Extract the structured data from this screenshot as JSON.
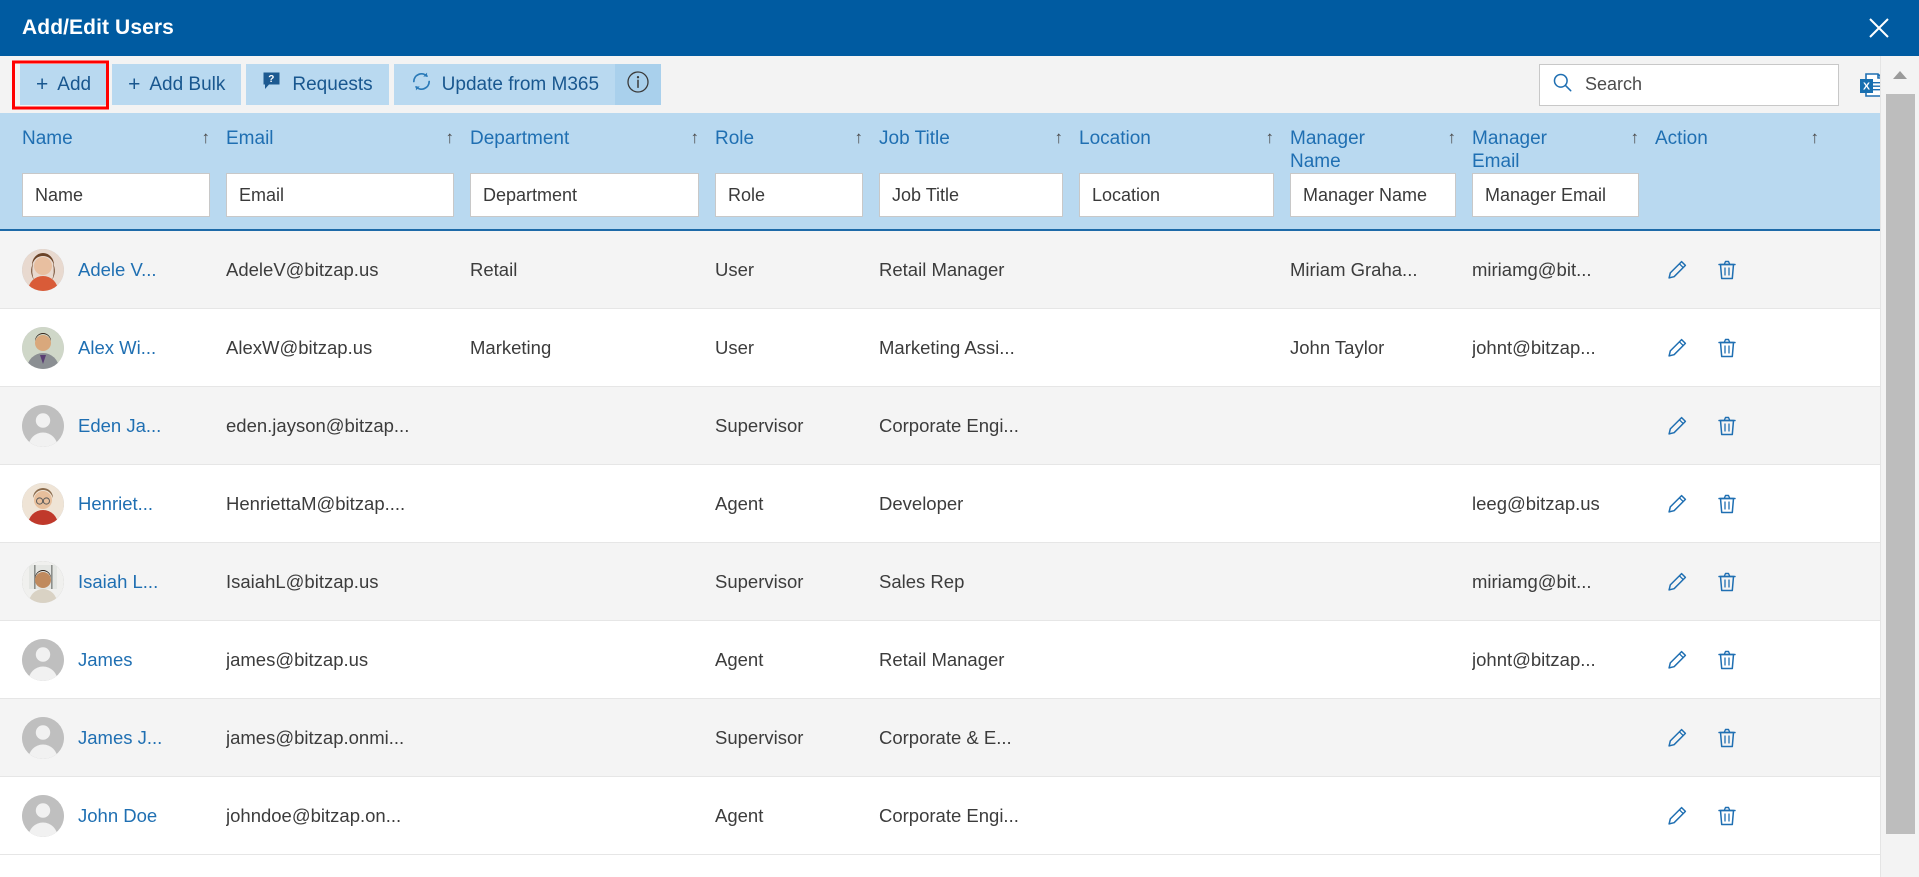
{
  "window": {
    "title": "Add/Edit Users",
    "close_label": "×",
    "accent_color": "#005ba1",
    "header_band_color": "#b9d9f0",
    "link_color": "#1f6fb2",
    "highlight_color": "#ff0000"
  },
  "toolbar": {
    "buttons": [
      {
        "id": "add",
        "label": "Add",
        "icon": "plus-icon",
        "highlighted": true
      },
      {
        "id": "add-bulk",
        "label": "Add Bulk",
        "icon": "plus-icon",
        "highlighted": false
      },
      {
        "id": "requests",
        "label": "Requests",
        "icon": "question-bubble-icon",
        "highlighted": false
      },
      {
        "id": "update-m365",
        "label": "Update from M365",
        "icon": "refresh-icon",
        "highlighted": false
      }
    ],
    "info_icon": "info-icon",
    "export_icon": "excel-export-icon"
  },
  "search": {
    "placeholder": "Search",
    "value": "",
    "icon": "search-icon"
  },
  "table": {
    "columns": [
      {
        "key": "name",
        "label": "Name",
        "filter_placeholder": "Name",
        "sort": "↑",
        "two_line": false
      },
      {
        "key": "email",
        "label": "Email",
        "filter_placeholder": "Email",
        "sort": "↑",
        "two_line": false
      },
      {
        "key": "department",
        "label": "Department",
        "filter_placeholder": "Department",
        "sort": "↑",
        "two_line": false
      },
      {
        "key": "role",
        "label": "Role",
        "filter_placeholder": "Role",
        "sort": "↑",
        "two_line": false
      },
      {
        "key": "job_title",
        "label": "Job Title",
        "filter_placeholder": "Job Title",
        "sort": "↑",
        "two_line": false
      },
      {
        "key": "location",
        "label": "Location",
        "filter_placeholder": "Location",
        "sort": "↑",
        "two_line": false
      },
      {
        "key": "manager_name",
        "label": "Manager Name",
        "filter_placeholder": "Manager Name",
        "sort": "↑",
        "two_line": true
      },
      {
        "key": "manager_email",
        "label": "Manager Email",
        "filter_placeholder": "Manager Email",
        "sort": "↑",
        "two_line": true
      },
      {
        "key": "action",
        "label": "Action",
        "filter_placeholder": "",
        "sort": "↑",
        "two_line": false
      }
    ],
    "rows": [
      {
        "name": "Adele V...",
        "email": "AdeleV@bitzap.us",
        "department": "Retail",
        "role": "User",
        "job_title": "Retail Manager",
        "location": "",
        "manager_name": "Miriam Graha...",
        "manager_email": "miriamg@bit...",
        "avatar": "photo-woman-brown-hair"
      },
      {
        "name": "Alex Wi...",
        "email": "AlexW@bitzap.us",
        "department": "Marketing",
        "role": "User",
        "job_title": "Marketing Assi...",
        "location": "",
        "manager_name": "John Taylor",
        "manager_email": "johnt@bitzap...",
        "avatar": "photo-man-grey-shirt"
      },
      {
        "name": "Eden Ja...",
        "email": "eden.jayson@bitzap...",
        "department": "",
        "role": "Supervisor",
        "job_title": "Corporate Engi...",
        "location": "",
        "manager_name": "",
        "manager_email": "",
        "avatar": "placeholder-person"
      },
      {
        "name": "Henriet...",
        "email": "HenriettaM@bitzap....",
        "department": "",
        "role": "Agent",
        "job_title": "Developer",
        "location": "",
        "manager_name": "",
        "manager_email": "leeg@bitzap.us",
        "avatar": "photo-woman-glasses"
      },
      {
        "name": "Isaiah L...",
        "email": "IsaiahL@bitzap.us",
        "department": "",
        "role": "Supervisor",
        "job_title": "Sales Rep",
        "location": "",
        "manager_name": "",
        "manager_email": "miriamg@bit...",
        "avatar": "photo-man-whiteboard"
      },
      {
        "name": "James",
        "email": "james@bitzap.us",
        "department": "",
        "role": "Agent",
        "job_title": "Retail Manager",
        "location": "",
        "manager_name": "",
        "manager_email": "johnt@bitzap...",
        "avatar": "placeholder-person"
      },
      {
        "name": "James J...",
        "email": "james@bitzap.onmi...",
        "department": "",
        "role": "Supervisor",
        "job_title": "Corporate & E...",
        "location": "",
        "manager_name": "",
        "manager_email": "",
        "avatar": "placeholder-person"
      },
      {
        "name": "John Doe",
        "email": "johndoe@bitzap.on...",
        "department": "",
        "role": "Agent",
        "job_title": "Corporate Engi...",
        "location": "",
        "manager_name": "",
        "manager_email": "",
        "avatar": "placeholder-person"
      }
    ],
    "row_actions": [
      {
        "id": "edit",
        "icon": "pencil-icon"
      },
      {
        "id": "delete",
        "icon": "trash-icon"
      }
    ]
  },
  "scrollbar": {
    "up_arrow_icon": "triangle-up-icon"
  }
}
